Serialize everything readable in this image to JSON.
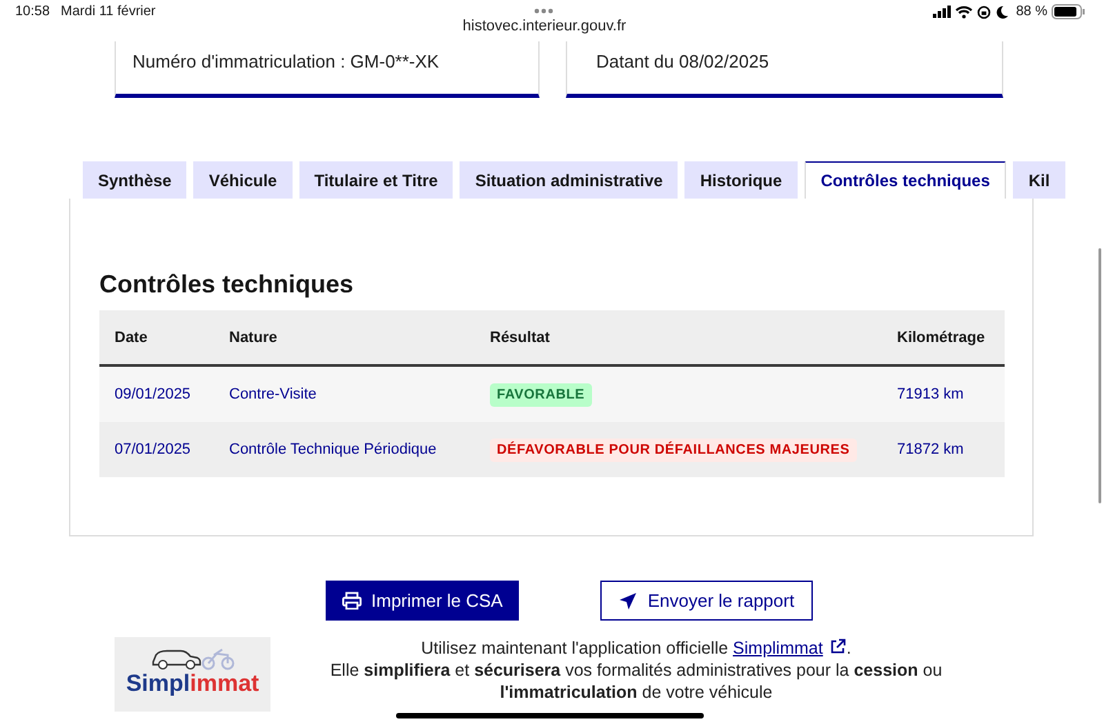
{
  "status_bar": {
    "time": "10:58",
    "date": "Mardi 11 février",
    "battery": "88 %"
  },
  "browser": {
    "url": "histovec.interieur.gouv.fr"
  },
  "summary_cards": [
    {
      "text": "Numéro d'immatriculation : GM-0**-XK"
    },
    {
      "text": "Datant du 08/02/2025"
    }
  ],
  "tabs": [
    {
      "label": "Synthèse",
      "selected": false
    },
    {
      "label": "Véhicule",
      "selected": false
    },
    {
      "label": "Titulaire et Titre",
      "selected": false
    },
    {
      "label": "Situation administrative",
      "selected": false
    },
    {
      "label": "Historique",
      "selected": false
    },
    {
      "label": "Contrôles techniques",
      "selected": true
    },
    {
      "label": "Kil",
      "selected": false
    }
  ],
  "section": {
    "title": "Contrôles techniques",
    "table": {
      "columns": [
        "Date",
        "Nature",
        "Résultat",
        "Kilométrage"
      ],
      "rows": [
        {
          "date": "09/01/2025",
          "nature": "Contre-Visite",
          "result": {
            "label": "FAVORABLE",
            "kind": "favorable"
          },
          "mileage": "71913 km"
        },
        {
          "date": "07/01/2025",
          "nature": "Contrôle Technique Périodique",
          "result": {
            "label": "DÉFAVORABLE POUR DÉFAILLANCES MAJEURES",
            "kind": "defavorable"
          },
          "mileage": "71872 km"
        }
      ]
    }
  },
  "buttons": [
    {
      "label": "Imprimer le CSA",
      "kind": "primary"
    },
    {
      "label": "Envoyer le rapport",
      "kind": "secondary"
    }
  ],
  "promo": {
    "logo_text_1": "Simpl",
    "logo_text_2": "immat",
    "intro": "Utilisez maintenant l'application officielle ",
    "link": "Simplimmat",
    "intro_end": ".",
    "text": "Elle **simplifiera** et **sécurisera** vos formalités administratives pour la **cession** ou **l'immatriculation** de votre véhicule"
  }
}
